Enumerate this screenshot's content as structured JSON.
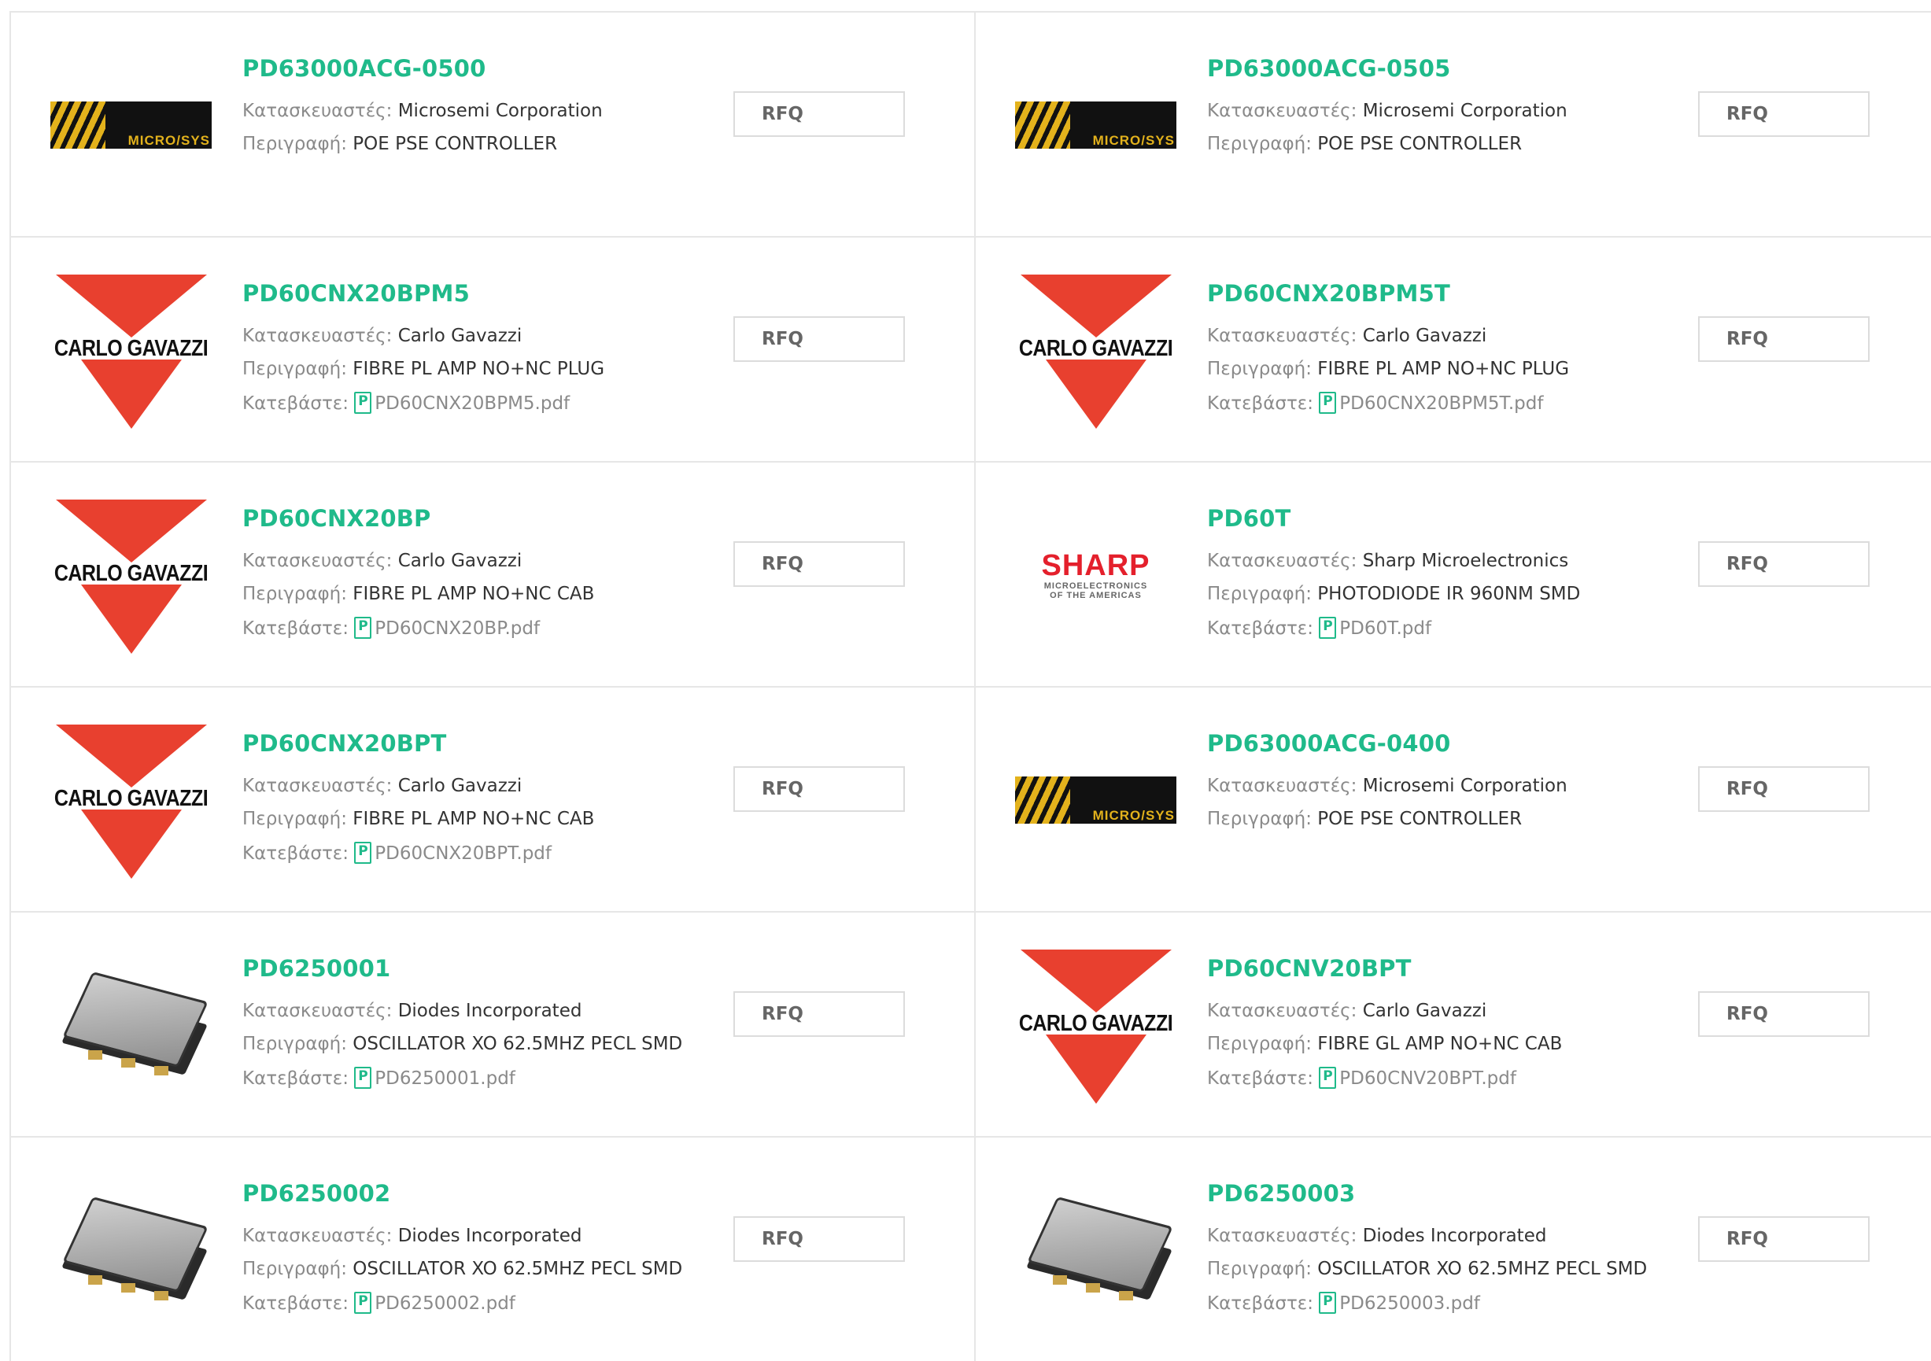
{
  "labels": {
    "manufacturer": "Κατασκευαστές:",
    "description": "Περιγραφή:",
    "download": "Κατεβάστε:",
    "rfq": "RFQ"
  },
  "logos": {
    "carlo_gavazzi": "CARLO GAVAZZI",
    "microsemi": "MICRO/SYS",
    "sharp_main": "SHARP",
    "sharp_sub1": "MICROELECTRONICS",
    "sharp_sub2": "OF THE AMERICAS"
  },
  "products": [
    {
      "part": "PD63000ACG-0500",
      "manufacturer": "Microsemi Corporation",
      "description": "POE PSE CONTROLLER",
      "file": "",
      "logo": "microsemi"
    },
    {
      "part": "PD63000ACG-0505",
      "manufacturer": "Microsemi Corporation",
      "description": "POE PSE CONTROLLER",
      "file": "",
      "logo": "microsemi"
    },
    {
      "part": "PD60CNX20BPM5",
      "manufacturer": "Carlo Gavazzi",
      "description": "FIBRE PL AMP NO+NC PLUG",
      "file": "PD60CNX20BPM5.pdf",
      "logo": "carlo_gavazzi"
    },
    {
      "part": "PD60CNX20BPM5T",
      "manufacturer": "Carlo Gavazzi",
      "description": "FIBRE PL AMP NO+NC PLUG",
      "file": "PD60CNX20BPM5T.pdf",
      "logo": "carlo_gavazzi"
    },
    {
      "part": "PD60CNX20BP",
      "manufacturer": "Carlo Gavazzi",
      "description": "FIBRE PL AMP NO+NC CAB",
      "file": "PD60CNX20BP.pdf",
      "logo": "carlo_gavazzi"
    },
    {
      "part": "PD60T",
      "manufacturer": "Sharp Microelectronics",
      "description": "PHOTODIODE IR 960NM SMD",
      "file": "PD60T.pdf",
      "logo": "sharp"
    },
    {
      "part": "PD60CNX20BPT",
      "manufacturer": "Carlo Gavazzi",
      "description": "FIBRE PL AMP NO+NC CAB",
      "file": "PD60CNX20BPT.pdf",
      "logo": "carlo_gavazzi"
    },
    {
      "part": "PD63000ACG-0400",
      "manufacturer": "Microsemi Corporation",
      "description": "POE PSE CONTROLLER",
      "file": "",
      "logo": "microsemi"
    },
    {
      "part": "PD6250001",
      "manufacturer": "Diodes Incorporated",
      "description": "OSCILLATOR XO 62.5MHZ PECL SMD",
      "file": "PD6250001.pdf",
      "logo": "oscillator"
    },
    {
      "part": "PD60CNV20BPT",
      "manufacturer": "Carlo Gavazzi",
      "description": "FIBRE GL AMP NO+NC CAB",
      "file": "PD60CNV20BPT.pdf",
      "logo": "carlo_gavazzi"
    },
    {
      "part": "PD6250002",
      "manufacturer": "Diodes Incorporated",
      "description": "OSCILLATOR XO 62.5MHZ PECL SMD",
      "file": "PD6250002.pdf",
      "logo": "oscillator"
    },
    {
      "part": "PD6250003",
      "manufacturer": "Diodes Incorporated",
      "description": "OSCILLATOR XO 62.5MHZ PECL SMD",
      "file": "PD6250003.pdf",
      "logo": "oscillator"
    }
  ]
}
